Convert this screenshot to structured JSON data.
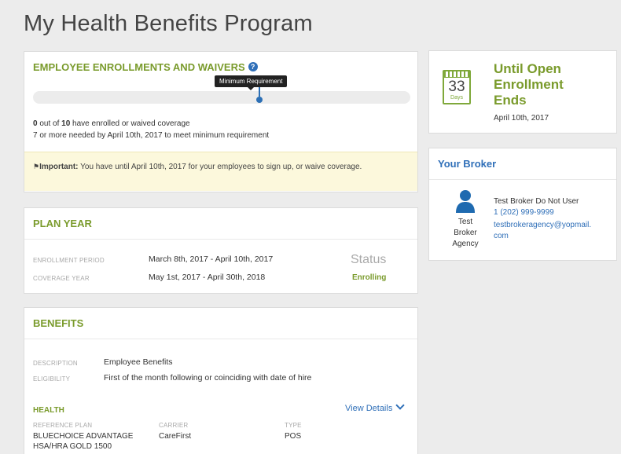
{
  "page_title": "My Health Benefits Program",
  "enrollment": {
    "title": "EMPLOYEE ENROLLMENTS AND WAIVERS",
    "tooltip": "Minimum Requirement",
    "progress": 0,
    "minimum_marker_fraction": 0.6,
    "enrolled_count": "0",
    "enrolled_mid": " out of ",
    "total_count": "10",
    "enrolled_suffix": " have enrolled or waived coverage",
    "needed_line": "7 or more needed by April 10th, 2017 to meet minimum requirement",
    "important_label": "Important:",
    "important_text": " You have until April 10th, 2017 for your employees to sign up, or waive coverage."
  },
  "plan_year": {
    "title": "PLAN YEAR",
    "enrollment_period_label": "ENROLLMENT PERIOD",
    "enrollment_period_value": "March 8th, 2017 - April 10th, 2017",
    "coverage_year_label": "COVERAGE YEAR",
    "coverage_year_value": "May 1st, 2017 - April 30th, 2018",
    "status_label": "Status",
    "status_value": "Enrolling"
  },
  "benefits": {
    "title": "BENEFITS",
    "description_label": "DESCRIPTION",
    "description_value": "Employee Benefits",
    "eligibility_label": "ELIGIBILITY",
    "eligibility_value": "First of the month following or coinciding with date of hire",
    "health_label": "HEALTH",
    "view_details": "View Details",
    "reference_plan_label": "REFERENCE PLAN",
    "reference_plan_value_1": "BLUECHOICE ADVANTAGE",
    "reference_plan_value_2": "HSA/HRA GOLD 1500",
    "carrier_label": "CARRIER",
    "carrier_value": "CareFirst",
    "type_label": "TYPE",
    "type_value": "POS"
  },
  "open_enrollment": {
    "days": "33",
    "days_label": "Days",
    "title_line1": "Until Open",
    "title_line2": "Enrollment",
    "title_line3": "Ends",
    "date": "April 10th, 2017"
  },
  "broker": {
    "title": "Your Broker",
    "agency_line1": "Test",
    "agency_line2": "Broker",
    "agency_line3": "Agency",
    "name": "Test Broker Do Not User",
    "phone": "1 (202) 999-9999",
    "email_line1": "testbrokeragency@yopmail.",
    "email_line2": "com"
  },
  "colors": {
    "accent_green": "#7a9b2c",
    "link_blue": "#2f6fb8",
    "notice_bg": "#fcf8dc"
  }
}
